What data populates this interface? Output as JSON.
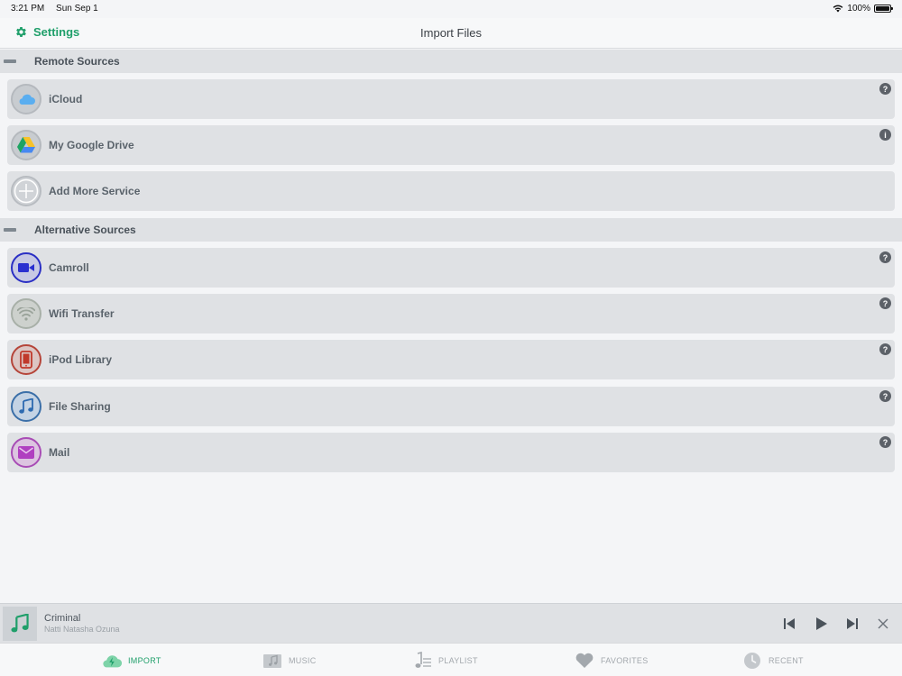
{
  "status_bar": {
    "time": "3:21 PM",
    "date": "Sun Sep 1",
    "battery": "100%"
  },
  "nav": {
    "settings_label": "Settings",
    "title": "Import Files"
  },
  "sections": {
    "remote": {
      "title": "Remote Sources",
      "items": [
        {
          "label": "iCloud",
          "badge": "?"
        },
        {
          "label": "My Google Drive",
          "badge": "i"
        },
        {
          "label": "Add More Service"
        }
      ]
    },
    "alternative": {
      "title": "Alternative Sources",
      "items": [
        {
          "label": "Camroll",
          "badge": "?"
        },
        {
          "label": "Wifi Transfer",
          "badge": "?"
        },
        {
          "label": "iPod Library",
          "badge": "?"
        },
        {
          "label": "File Sharing",
          "badge": "?"
        },
        {
          "label": "Mail",
          "badge": "?"
        }
      ]
    }
  },
  "now_playing": {
    "title": "Criminal",
    "artist": "Natti Natasha Ozuna"
  },
  "tabs": [
    {
      "label": "IMPORT",
      "icon": "import-icon",
      "active": true
    },
    {
      "label": "MUSIC",
      "icon": "music-icon"
    },
    {
      "label": "PLAYLIST",
      "icon": "playlist-icon"
    },
    {
      "label": "FAVORITES",
      "icon": "heart-icon"
    },
    {
      "label": "RECENT",
      "icon": "clock-icon"
    }
  ],
  "colors": {
    "accent": "#1f9f6a",
    "row_bg": "#dfe1e4",
    "page_bg": "#f4f5f7"
  }
}
